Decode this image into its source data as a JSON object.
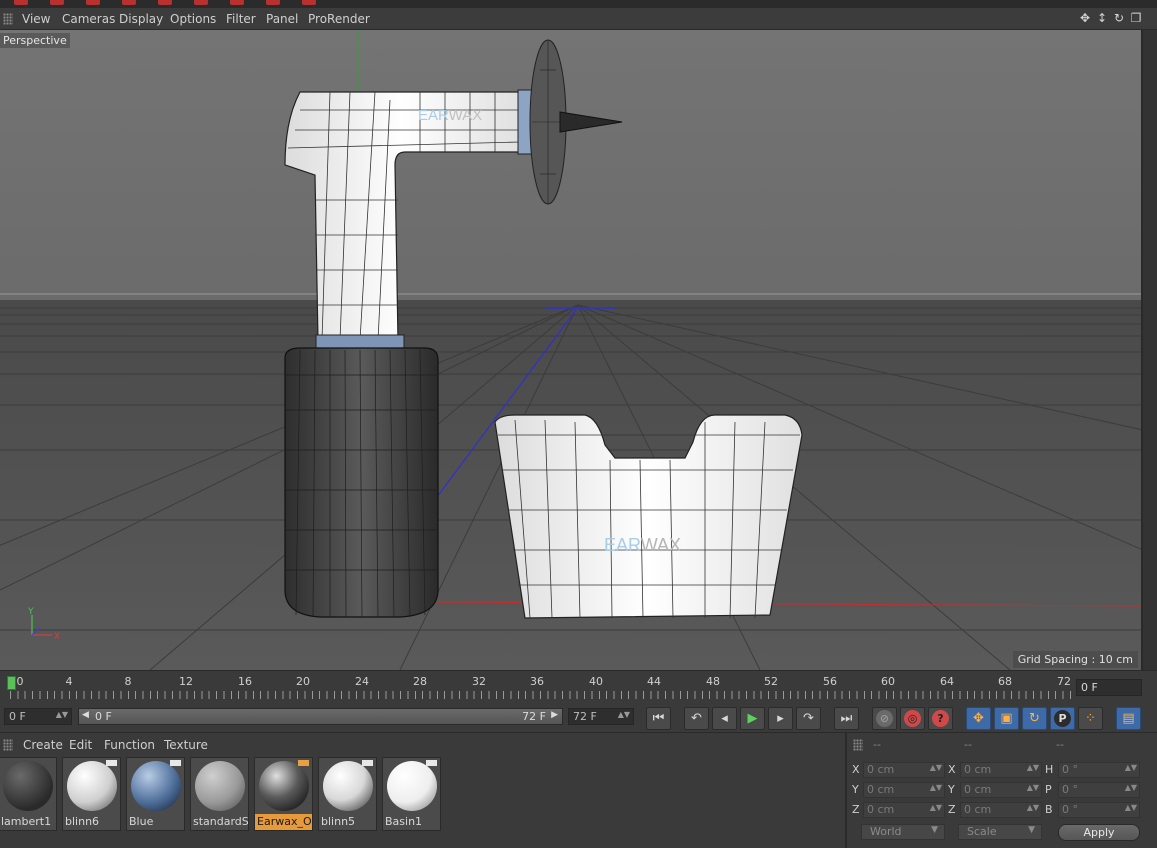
{
  "menubar": {
    "items": [
      "View",
      "Cameras",
      "Display",
      "Options",
      "Filter",
      "Panel",
      "ProRender"
    ]
  },
  "viewport": {
    "label": "Perspective",
    "grid_spacing": "Grid Spacing : 10 cm",
    "logo_text_a": "EAR",
    "logo_text_b": "WAX",
    "axis_y": "Y",
    "axis_x": "X"
  },
  "timeline": {
    "ticks": [
      "0",
      "4",
      "8",
      "12",
      "16",
      "20",
      "24",
      "28",
      "32",
      "36",
      "40",
      "44",
      "48",
      "52",
      "56",
      "60",
      "64",
      "68",
      "72"
    ],
    "current_frame": "0 F"
  },
  "transport": {
    "start_frame": "0 F",
    "range_start": "0 F",
    "range_end": "72 F",
    "end_frame": "72 F"
  },
  "material_menu": {
    "items": [
      "Create",
      "Edit",
      "Function",
      "Texture"
    ]
  },
  "materials": [
    {
      "name": "lambert1",
      "color": "#4a4a4a"
    },
    {
      "name": "blinn6",
      "color": "#f2f2f2"
    },
    {
      "name": "Blue",
      "color": "#4f6f9a"
    },
    {
      "name": "standardSu",
      "color": "#9a9a9a"
    },
    {
      "name": "Earwax_Op",
      "color": "#2f2f2f"
    },
    {
      "name": "blinn5",
      "color": "#e6e6e6"
    },
    {
      "name": "Basin1",
      "color": "#f5f5f5"
    }
  ],
  "coordinates": {
    "headers": [
      "--",
      "--",
      "--"
    ],
    "pos_labels": [
      "X",
      "Y",
      "Z"
    ],
    "size_labels": [
      "X",
      "Y",
      "Z"
    ],
    "rot_labels": [
      "H",
      "P",
      "B"
    ],
    "pos_values": [
      "0 cm",
      "0 cm",
      "0 cm"
    ],
    "size_values": [
      "0 cm",
      "0 cm",
      "0 cm"
    ],
    "rot_values": [
      "0 °",
      "0 °",
      "0 °"
    ],
    "space": "World",
    "mode": "Scale",
    "apply_label": "Apply"
  }
}
